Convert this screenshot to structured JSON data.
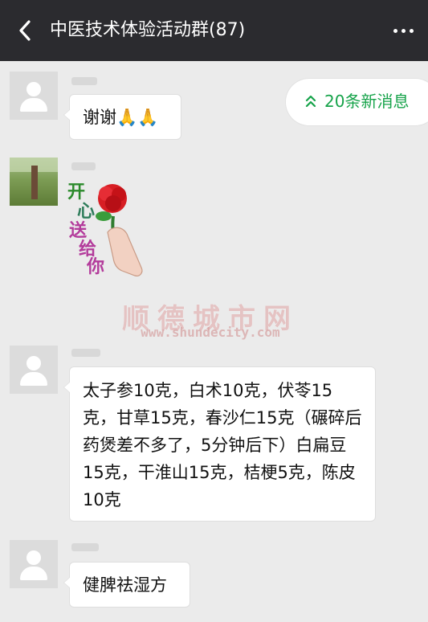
{
  "header": {
    "title": "中医技术体验活动群(87)"
  },
  "new_messages": {
    "label": "20条新消息"
  },
  "messages": [
    {
      "text": "谢谢🙏🙏"
    },
    {
      "sticker_text": [
        "开",
        "心",
        "送",
        "给",
        "你"
      ]
    },
    {
      "text": "太子参10克，白术10克，伏苓15克，甘草15克，春沙仁15克（碾碎后药煲差不多了，5分钟后下）白扁豆15克，干淮山15克，桔梗5克，陈皮10克"
    },
    {
      "text": "健脾祛湿方"
    }
  ],
  "watermark": {
    "title": "顺德城市网",
    "url": "www.shundecity.com"
  },
  "icons": {
    "back": "chevron-left-icon",
    "more": "more-horizontal-icon",
    "new_messages": "double-chevron-up-icon",
    "avatar_default": "user-icon"
  },
  "colors": {
    "header_bg": "#2b2b2f",
    "page_bg": "#ebebeb",
    "accent_green": "#16a34a"
  }
}
